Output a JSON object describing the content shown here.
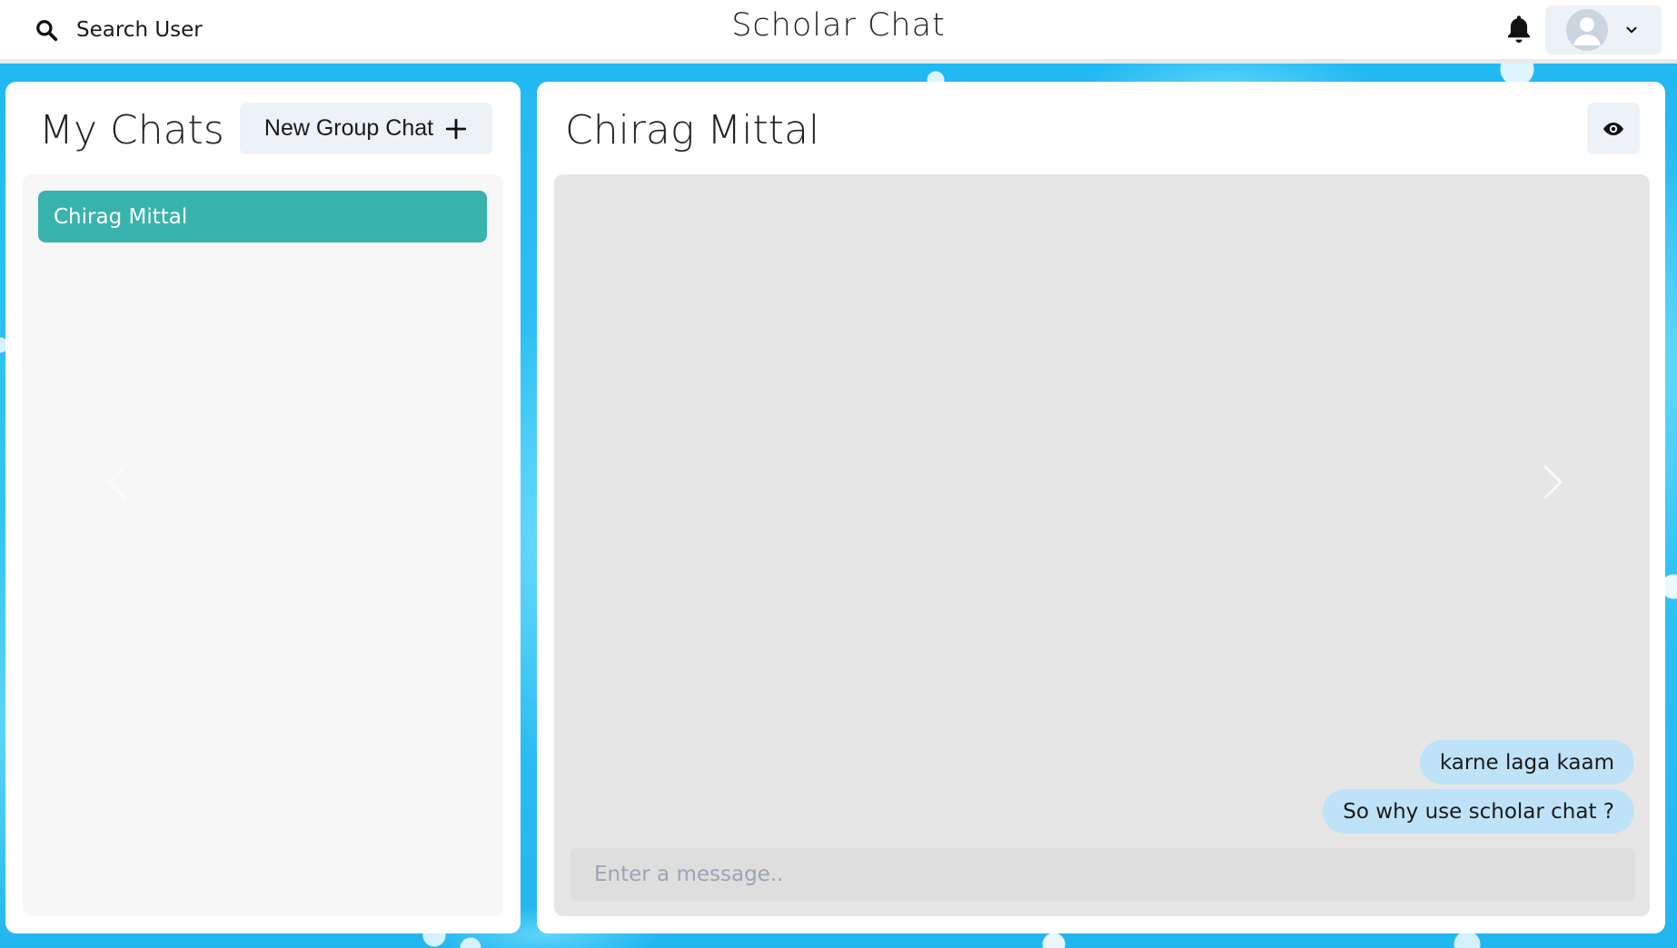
{
  "header": {
    "search_label": "Search User",
    "app_title": "Scholar Chat",
    "icons": {
      "search": "search-icon",
      "notifications": "bell-icon",
      "avatar": "user-avatar-icon",
      "menu": "chevron-down-icon"
    }
  },
  "sidebar": {
    "title": "My Chats",
    "new_group_label": "New Group Chat",
    "new_group_icon": "plus-icon",
    "chats": [
      {
        "name": "Chirag Mittal",
        "selected": true
      }
    ]
  },
  "chat": {
    "partner_name": "Chirag Mittal",
    "view_profile_icon": "eye-icon",
    "messages": [
      {
        "text": "karne laga kaam",
        "from_self": true
      },
      {
        "text": "So why use scholar chat ?",
        "from_self": true
      }
    ],
    "input": {
      "value": "",
      "placeholder": "Enter a message.."
    }
  },
  "colors": {
    "background": "#28bdf3",
    "selected_chat": "#38b2ac",
    "message_bubble": "#bee3f8",
    "button_bg": "#edf2f7"
  }
}
